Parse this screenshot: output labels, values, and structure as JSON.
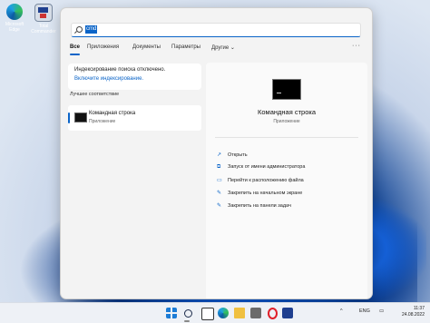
{
  "desktop": {
    "icons": [
      {
        "label": "Microsoft Edge",
        "icon": "edge-icon"
      },
      {
        "label": "Total Commander",
        "icon": "total-commander-icon"
      }
    ]
  },
  "search": {
    "query": "cmd",
    "tabs": [
      "Все",
      "Приложения",
      "Документы",
      "Параметры",
      "Другие ⌄"
    ],
    "more_label": "···",
    "index_notice": "Индексирование поиска отключено.",
    "index_link": "Включите индексирование.",
    "best_match_header": "Лучшее соответствие",
    "best_match": {
      "title": "Командная строка",
      "subtitle": "Приложение"
    },
    "detail": {
      "title": "Командная строка",
      "subtitle": "Приложение",
      "actions": [
        {
          "icon": "open-icon",
          "glyph": "↗",
          "label": "Открыть"
        },
        {
          "icon": "admin-icon",
          "glyph": "⧉",
          "label": "Запуск от имени администратора"
        },
        {
          "icon": "folder-icon",
          "glyph": "▭",
          "label": "Перейти к расположению файла"
        },
        {
          "icon": "pin-icon",
          "glyph": "✎",
          "label": "Закрепить на начальном экране"
        },
        {
          "icon": "pin-icon",
          "glyph": "✎",
          "label": "Закрепить на панели задач"
        }
      ]
    }
  },
  "taskbar": {
    "tray_chevron": "^",
    "language": "ENG",
    "time": "11:37",
    "date": "24.08.2022"
  },
  "colors": {
    "accent": "#0a64c8",
    "panel": "#f3f3f3"
  }
}
